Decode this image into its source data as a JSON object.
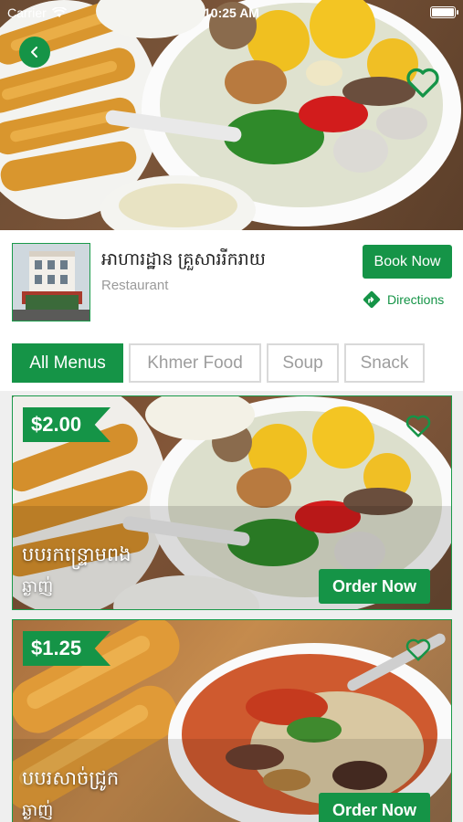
{
  "status_bar": {
    "carrier": "Carrier",
    "time": "10:25 AM"
  },
  "hero": {
    "image": "rice-porridge-hero-photo"
  },
  "vendor": {
    "name": "អាហារដ្ឋាន គ្រួសាររីករាយ",
    "type": "Restaurant",
    "book_label": "Book Now",
    "directions_label": "Directions"
  },
  "tabs": [
    {
      "label": "All Menus",
      "active": true
    },
    {
      "label": "Khmer Food",
      "active": false
    },
    {
      "label": "Soup",
      "active": false
    },
    {
      "label": "Snack",
      "active": false
    }
  ],
  "menu_items": [
    {
      "price": "$2.00",
      "name": "បបរកន្ទ្រោមពង",
      "subtitle": "ឆ្ងាញ់",
      "order_label": "Order Now"
    },
    {
      "price": "$1.25",
      "name": "បបរសាច់ជ្រូក",
      "subtitle": "ឆ្ងាញ់",
      "order_label": "Order Now"
    }
  ],
  "colors": {
    "accent": "#159447",
    "tab_border": "#d9d9d9"
  },
  "icons": [
    "back-arrow-icon",
    "heart-outline-icon",
    "directions-icon",
    "wifi-icon",
    "battery-icon"
  ]
}
